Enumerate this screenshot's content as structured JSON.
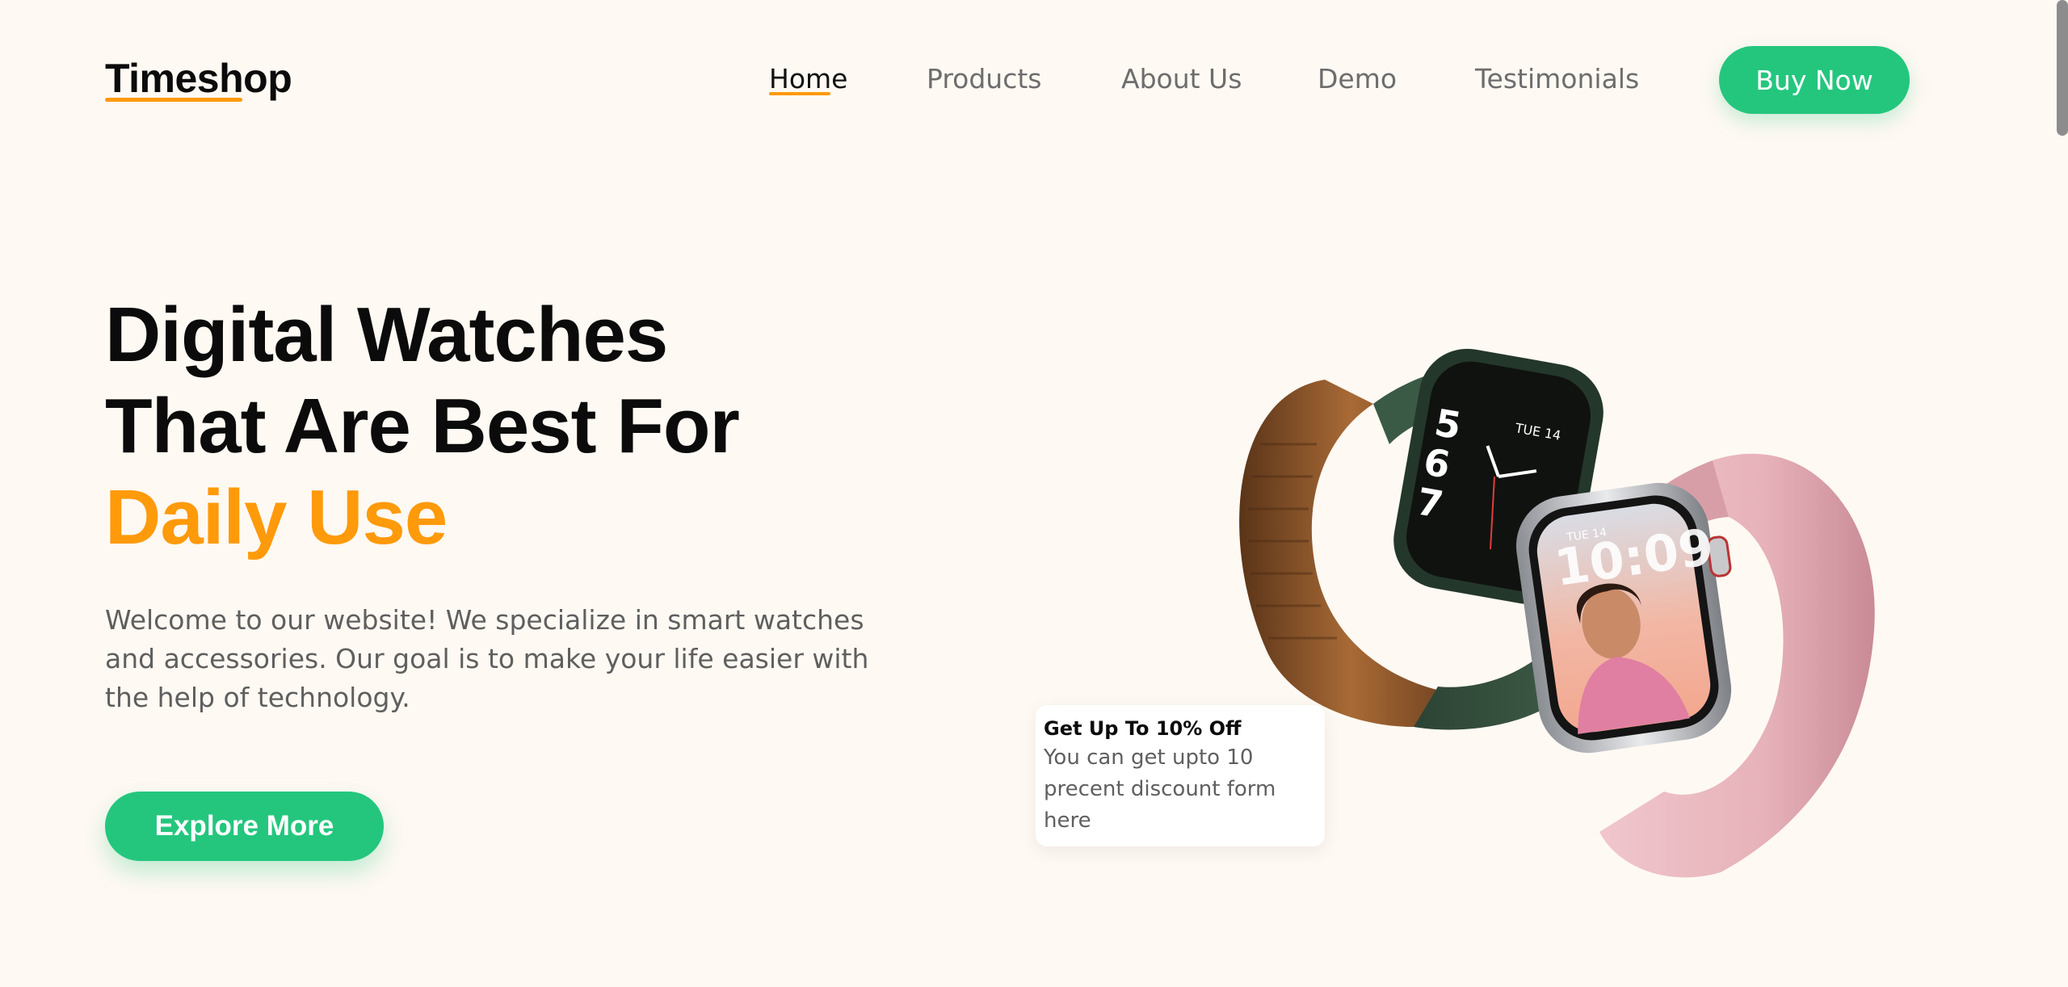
{
  "header": {
    "logo": "Timeshop",
    "nav": [
      "Home",
      "Products",
      "About Us",
      "Demo",
      "Testimonials"
    ],
    "active_nav": "Home",
    "cta_label": "Buy Now"
  },
  "hero": {
    "title_line1": "Digital Watches",
    "title_line2": "That Are Best For",
    "title_accent": "Daily Use",
    "description": "Welcome to our website! We specialize in smart watches and accessories. Our goal is to make your life easier with the help of technology.",
    "button_label": "Explore More"
  },
  "promo": {
    "title": "Get Up To 10% Off",
    "text": "You can get upto 10 precent discount form here"
  },
  "watch_faces": {
    "back_day": "TUE 14",
    "front_day": "TUE 14",
    "front_time": "10:09"
  },
  "colors": {
    "background": "#fff9f3",
    "accent_orange": "#ff9a0a",
    "brand_green": "#24c67e"
  }
}
